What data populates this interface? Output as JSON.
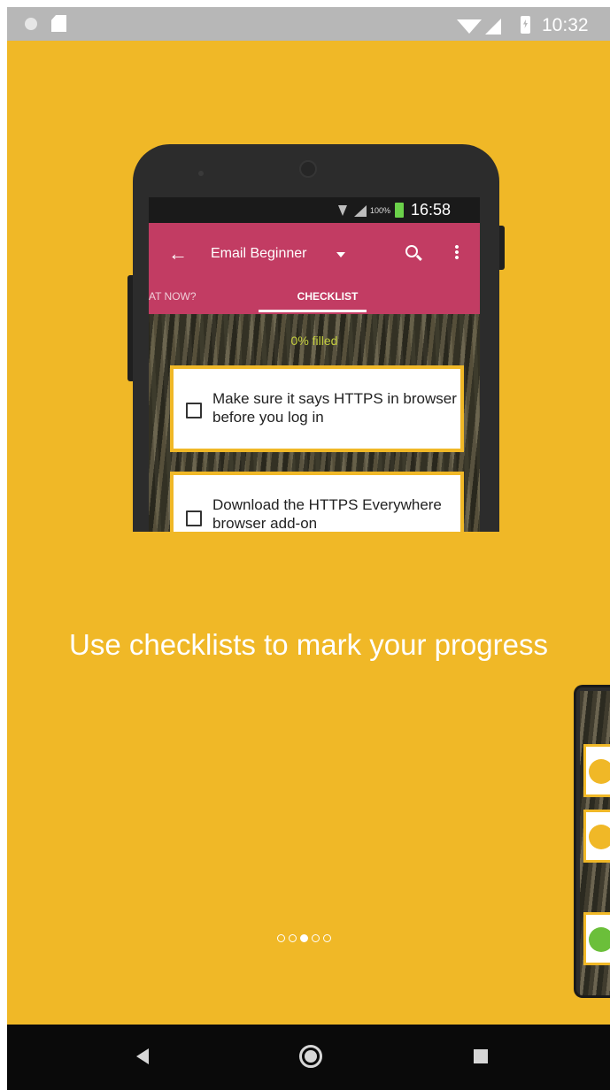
{
  "status_bar": {
    "time": "10:32",
    "icons": [
      "notification-dot-icon",
      "sd-card-icon",
      "wifi-icon",
      "signal-icon",
      "battery-charging-icon"
    ]
  },
  "phone_mockup": {
    "status_bar": {
      "battery_percent": "100%",
      "time": "16:58"
    },
    "app_bar": {
      "title": "Email Beginner",
      "icons": [
        "back-arrow-icon",
        "dropdown-caret-icon",
        "search-icon",
        "more-vert-icon"
      ]
    },
    "tabs": [
      {
        "label": "AT NOW?",
        "active": false
      },
      {
        "label": "CHECKLIST",
        "active": true
      }
    ],
    "progress_text": "0% filled",
    "checklist": [
      {
        "text": "Make sure it says HTTPS in browser before you log in",
        "checked": false
      },
      {
        "text": "Download the HTTPS Everywhere browser add-on",
        "checked": false
      }
    ]
  },
  "headline": "Use checklists to mark your progress",
  "pager": {
    "total": 5,
    "active_index": 2
  },
  "colors": {
    "background": "#f0b827",
    "app_bar": "#c23c63",
    "progress_text": "#c5cf3f",
    "status_bar": "#b7b7b7",
    "nav_bar": "#0a0a0a"
  },
  "nav_bar": {
    "buttons": [
      "back-icon",
      "home-icon",
      "recents-icon"
    ]
  }
}
